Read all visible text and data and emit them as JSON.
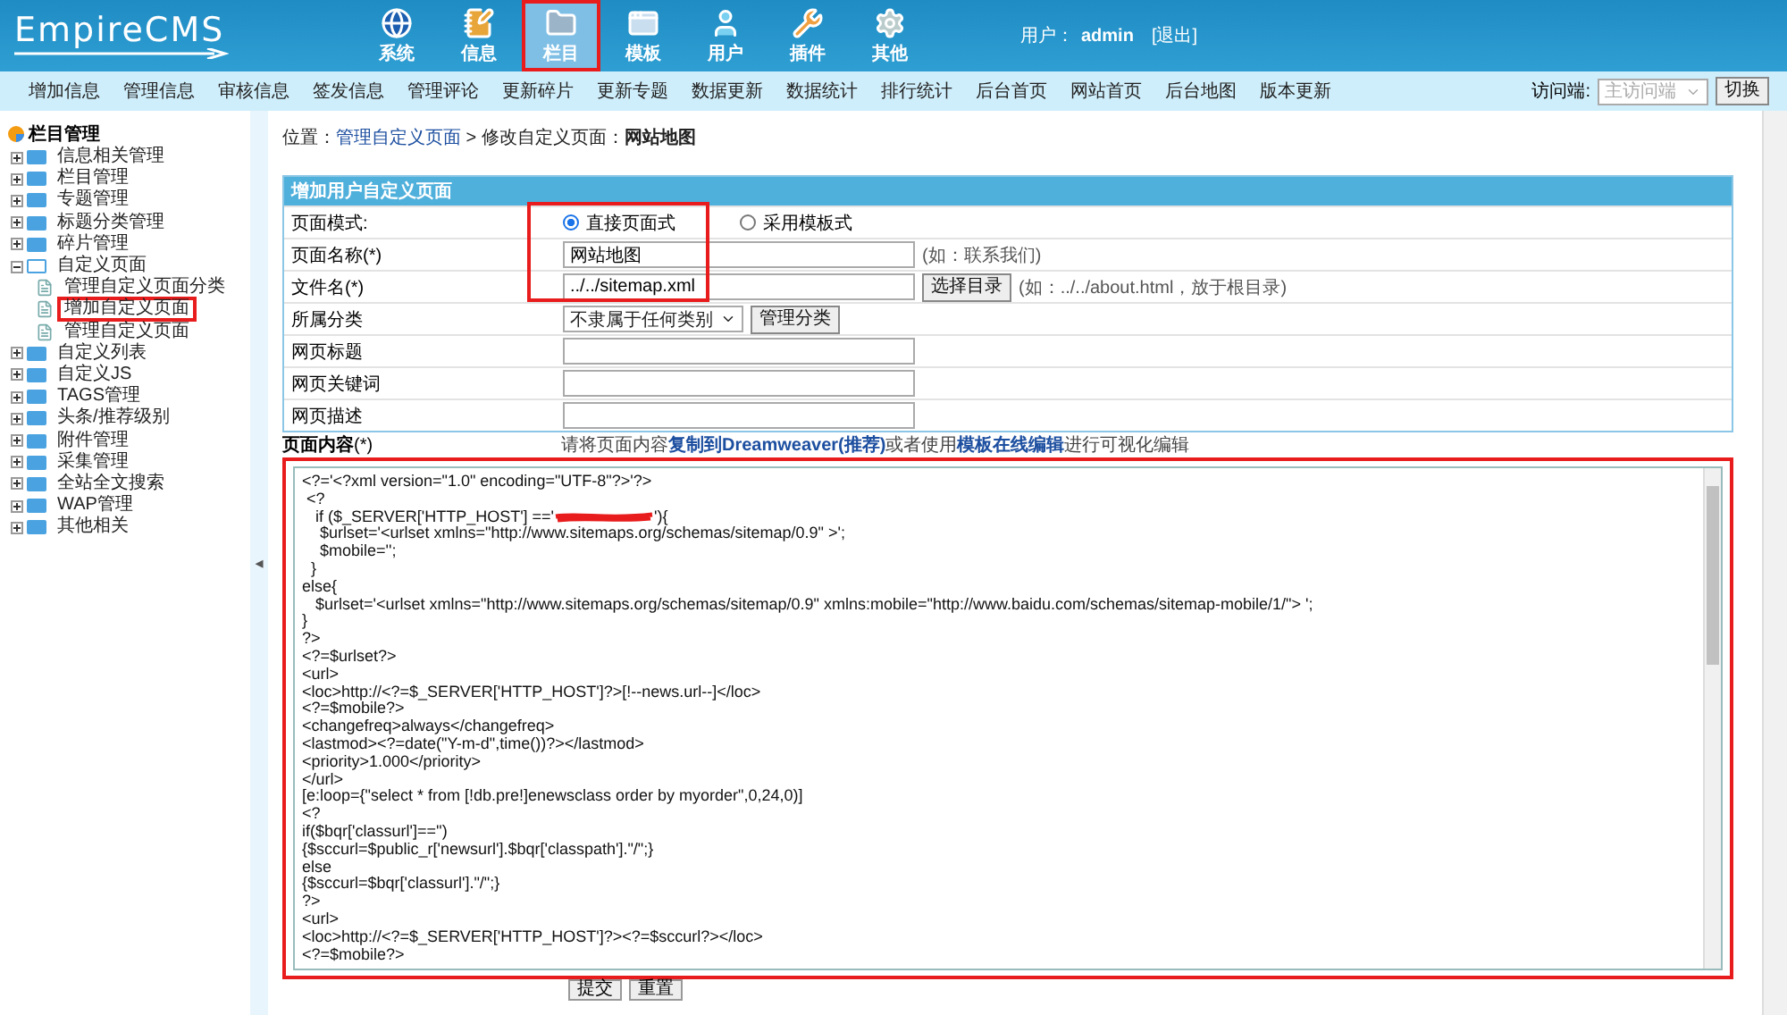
{
  "header": {
    "logo": "EmpireCMS",
    "nav": [
      {
        "label": "系统",
        "selected": false,
        "annotated": false
      },
      {
        "label": "信息",
        "selected": false,
        "annotated": false
      },
      {
        "label": "栏目",
        "selected": true,
        "annotated": true
      },
      {
        "label": "模板",
        "selected": false,
        "annotated": false
      },
      {
        "label": "用户",
        "selected": false,
        "annotated": false
      },
      {
        "label": "插件",
        "selected": false,
        "annotated": false
      },
      {
        "label": "其他",
        "selected": false,
        "annotated": false
      }
    ],
    "user_label": "用户：",
    "user_name": "admin",
    "logout": "[退出]"
  },
  "toolbar": {
    "items": [
      "增加信息",
      "管理信息",
      "审核信息",
      "签发信息",
      "管理评论",
      "更新碎片",
      "更新专题",
      "数据更新",
      "数据统计",
      "排行统计",
      "后台首页",
      "网站首页",
      "后台地图",
      "版本更新"
    ],
    "access_label": "访问端:",
    "access_value": "主访问端",
    "access_disabled": true,
    "switch_button": "切换"
  },
  "sidebar": {
    "title": "栏目管理",
    "collapse_arrow": "◂",
    "items": [
      {
        "label": "信息相关管理",
        "expanded": false
      },
      {
        "label": "栏目管理",
        "expanded": false
      },
      {
        "label": "专题管理",
        "expanded": false
      },
      {
        "label": "标题分类管理",
        "expanded": false
      },
      {
        "label": "碎片管理",
        "expanded": false
      },
      {
        "label": "自定义页面",
        "expanded": true,
        "children": [
          {
            "label": "管理自定义页面分类",
            "annotated": false
          },
          {
            "label": "增加自定义页面",
            "annotated": true
          },
          {
            "label": "管理自定义页面",
            "annotated": false
          }
        ]
      },
      {
        "label": "自定义列表",
        "expanded": false
      },
      {
        "label": "自定义JS",
        "expanded": false
      },
      {
        "label": "TAGS管理",
        "expanded": false
      },
      {
        "label": "头条/推荐级别",
        "expanded": false
      },
      {
        "label": "附件管理",
        "expanded": false
      },
      {
        "label": "采集管理",
        "expanded": false
      },
      {
        "label": "全站全文搜索",
        "expanded": false
      },
      {
        "label": "WAP管理",
        "expanded": false
      },
      {
        "label": "其他相关",
        "expanded": false
      }
    ]
  },
  "breadcrumb": {
    "label": "位置：",
    "link": "管理自定义页面",
    "separator": " > 修改自定义页面：",
    "current": "网站地图"
  },
  "form": {
    "title": "增加用户自定义页面",
    "rows": [
      {
        "kind": "radio",
        "label": "页面模式:",
        "annotated": true,
        "options": [
          {
            "label": "直接页面式",
            "selected": true
          },
          {
            "label": "采用模板式",
            "selected": false
          }
        ]
      },
      {
        "kind": "text",
        "label": "页面名称(*)",
        "annotated": true,
        "value": "网站地图",
        "hint": "(如：联系我们)"
      },
      {
        "kind": "text_button",
        "label": "文件名(*)",
        "annotated": true,
        "value": "../../sitemap.xml",
        "button": "选择目录",
        "hint": "(如：../../about.html，放于根目录)"
      },
      {
        "kind": "select_button",
        "label": "所属分类",
        "annotated": false,
        "value": "不隶属于任何类别",
        "button": "管理分类"
      },
      {
        "kind": "text",
        "label": "网页标题",
        "annotated": false
      },
      {
        "kind": "text",
        "label": "网页关键词",
        "annotated": false
      },
      {
        "kind": "text",
        "label": "网页描述",
        "annotated": false
      }
    ],
    "content": {
      "label": "**页面内容**(*)",
      "note": [
        {
          "text": "请将页面内容",
          "link": false
        },
        {
          "text": "复制到Dreamweaver(推荐)",
          "link": true
        },
        {
          "text": "或者使用",
          "link": false
        },
        {
          "text": "模板在线编辑",
          "link": true
        },
        {
          "text": "进行可视化编辑",
          "link": false
        }
      ],
      "annotated": true,
      "code_lines": [
        {
          "kind": "plain",
          "text": "<?='<?xml version=\"1.0\" encoding=\"UTF-8\"?>'?>"
        },
        {
          "kind": "plain",
          "text": " <?"
        },
        {
          "kind": "redacted",
          "before": "   if ($_SERVER['HTTP_HOST'] =='",
          "after": "'){"
        },
        {
          "kind": "plain",
          "text": "    $urlset='<urlset xmlns=\"http://www.sitemaps.org/schemas/sitemap/0.9\" >';"
        },
        {
          "kind": "plain",
          "text": "    $mobile='';"
        },
        {
          "kind": "plain",
          "text": "  }"
        },
        {
          "kind": "plain",
          "text": "else{"
        },
        {
          "kind": "plain",
          "text": "   $urlset='<urlset xmlns=\"http://www.sitemaps.org/schemas/sitemap/0.9\" xmlns:mobile=\"http://www.baidu.com/schemas/sitemap-mobile/1/\"> ';"
        },
        {
          "kind": "plain",
          "text": "}"
        },
        {
          "kind": "plain",
          "text": "?>"
        },
        {
          "kind": "plain",
          "text": "<?=$urlset?>"
        },
        {
          "kind": "plain",
          "text": "<url>"
        },
        {
          "kind": "plain",
          "text": "<loc>http://<?=$_SERVER['HTTP_HOST']?>[!--news.url--]</loc>"
        },
        {
          "kind": "plain",
          "text": "<?=$mobile?>"
        },
        {
          "kind": "plain",
          "text": "<changefreq>always</changefreq>"
        },
        {
          "kind": "plain",
          "text": "<lastmod><?=date(\"Y-m-d\",time())?></lastmod>"
        },
        {
          "kind": "plain",
          "text": "<priority>1.000</priority>"
        },
        {
          "kind": "plain",
          "text": "</url>"
        },
        {
          "kind": "plain",
          "text": "[e:loop={\"select * from [!db.pre!]enewsclass order by myorder\",0,24,0)]"
        },
        {
          "kind": "plain",
          "text": "<?"
        },
        {
          "kind": "plain",
          "text": "if($bqr['classurl']=='')"
        },
        {
          "kind": "plain",
          "text": "{$sccurl=$public_r['newsurl'].$bqr['classpath'].\"/\";}"
        },
        {
          "kind": "plain",
          "text": "else"
        },
        {
          "kind": "plain",
          "text": "{$sccurl=$bqr['classurl'].\"/\";}"
        },
        {
          "kind": "plain",
          "text": "?>"
        },
        {
          "kind": "plain",
          "text": "<url>"
        },
        {
          "kind": "plain",
          "text": "<loc>http://<?=$_SERVER['HTTP_HOST']?><?=$sccurl?></loc>"
        },
        {
          "kind": "plain",
          "text": "<?=$mobile?>"
        }
      ]
    },
    "buttons": [
      "提交",
      "重置"
    ]
  }
}
